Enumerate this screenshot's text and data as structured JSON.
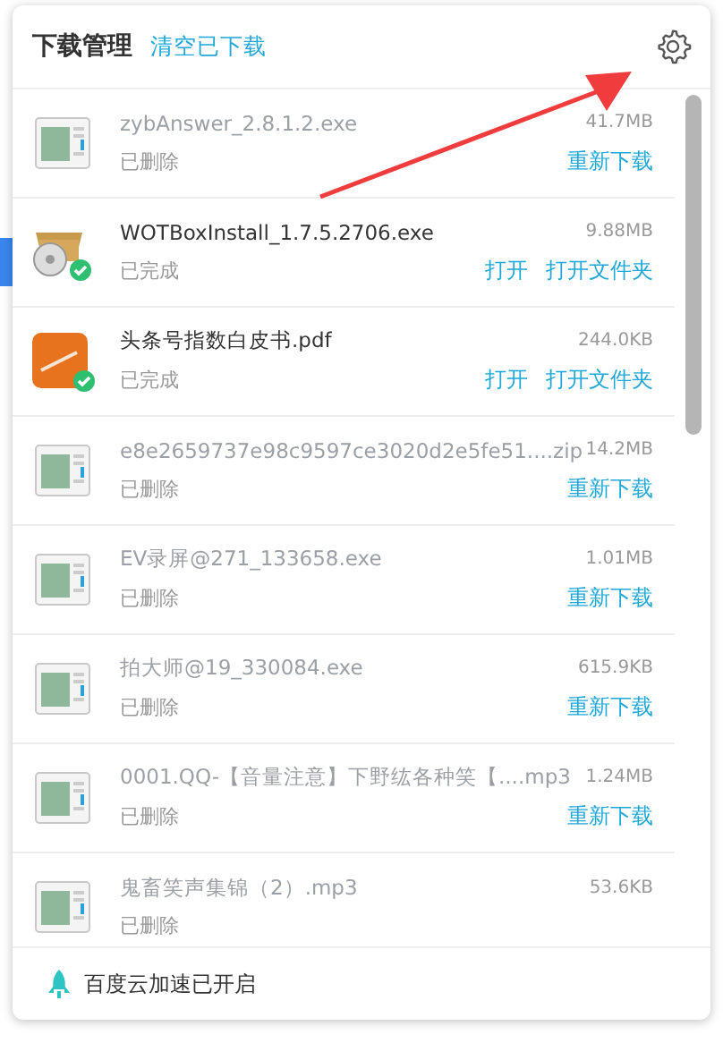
{
  "header": {
    "title": "下载管理",
    "clear_link": "清空已下载"
  },
  "downloads": [
    {
      "name": "zybAnswer_2.8.1.2.exe",
      "size": "41.7MB",
      "status": "已删除",
      "deleted": true,
      "kind": "file",
      "actions": [
        "重新下载"
      ]
    },
    {
      "name": "WOTBoxInstall_1.7.5.2706.exe",
      "size": "9.88MB",
      "status": "已完成",
      "deleted": false,
      "kind": "installer",
      "actions": [
        "打开",
        "打开文件夹"
      ]
    },
    {
      "name": "头条号指数白皮书.pdf",
      "size": "244.0KB",
      "status": "已完成",
      "deleted": false,
      "kind": "pdf",
      "actions": [
        "打开",
        "打开文件夹"
      ]
    },
    {
      "name": "e8e2659737e98c9597ce3020d2e5fe51....zip",
      "size": "14.2MB",
      "status": "已删除",
      "deleted": true,
      "kind": "file",
      "actions": [
        "重新下载"
      ]
    },
    {
      "name": "EV录屏@271_133658.exe",
      "size": "1.01MB",
      "status": "已删除",
      "deleted": true,
      "kind": "file",
      "actions": [
        "重新下载"
      ]
    },
    {
      "name": "拍大师@19_330084.exe",
      "size": "615.9KB",
      "status": "已删除",
      "deleted": true,
      "kind": "file",
      "actions": [
        "重新下载"
      ]
    },
    {
      "name": "0001.QQ-【音量注意】下野纮各种笑【....mp3",
      "size": "1.24MB",
      "status": "已删除",
      "deleted": true,
      "kind": "file",
      "actions": [
        "重新下载"
      ]
    },
    {
      "name": "鬼畜笑声集锦（2）.mp3",
      "size": "53.6KB",
      "status": "已删除",
      "deleted": true,
      "kind": "file"
    }
  ],
  "footer": {
    "text": "百度云加速已开启"
  }
}
